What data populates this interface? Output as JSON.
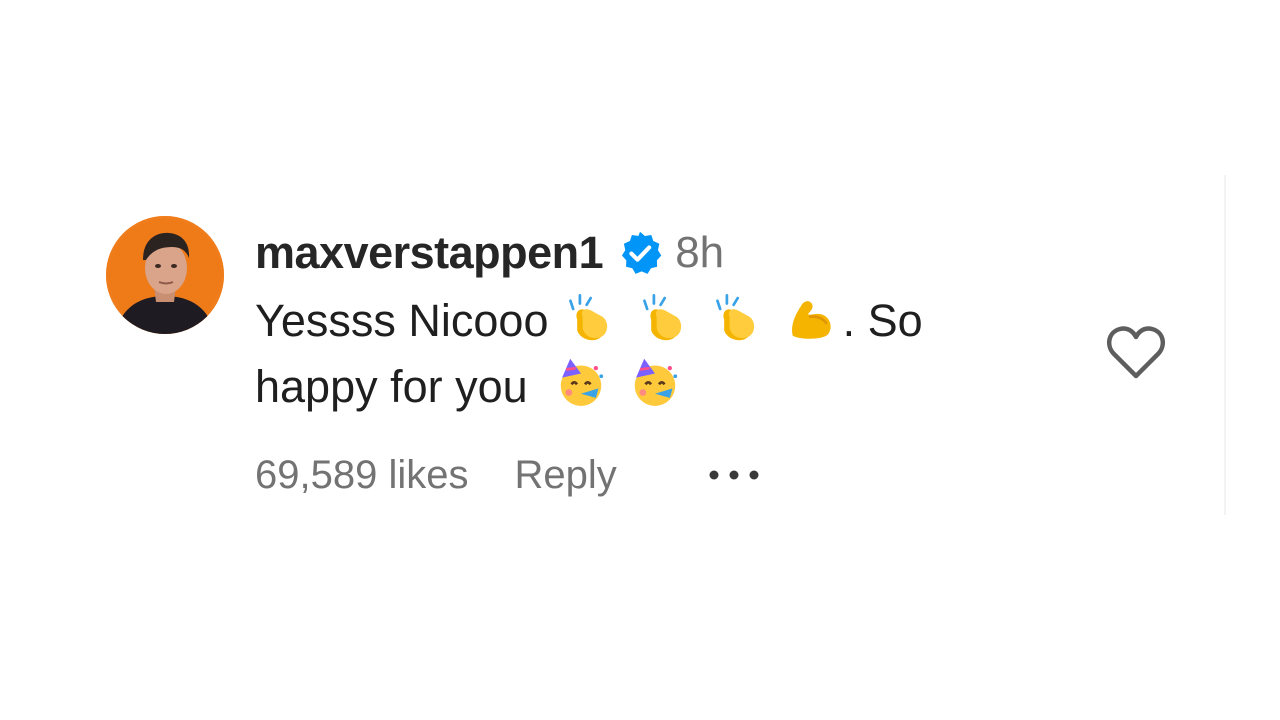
{
  "comment": {
    "username": "maxverstappen1",
    "verified": true,
    "time": "8h",
    "text_part1": "Yessss Nicooo",
    "text_part2": ". So",
    "text_part3": "happy for you",
    "likes": "69,589 likes",
    "reply_label": "Reply",
    "icons": {
      "verified": "verified-badge-icon",
      "clap": "clapping-hands-emoji",
      "muscle": "flexed-biceps-emoji",
      "party": "partying-face-emoji",
      "more": "more-options-icon",
      "like": "heart-icon"
    }
  },
  "colors": {
    "verified_blue": "#0095f6",
    "secondary_text": "#737373",
    "avatar_bg": "#f07d1c"
  }
}
